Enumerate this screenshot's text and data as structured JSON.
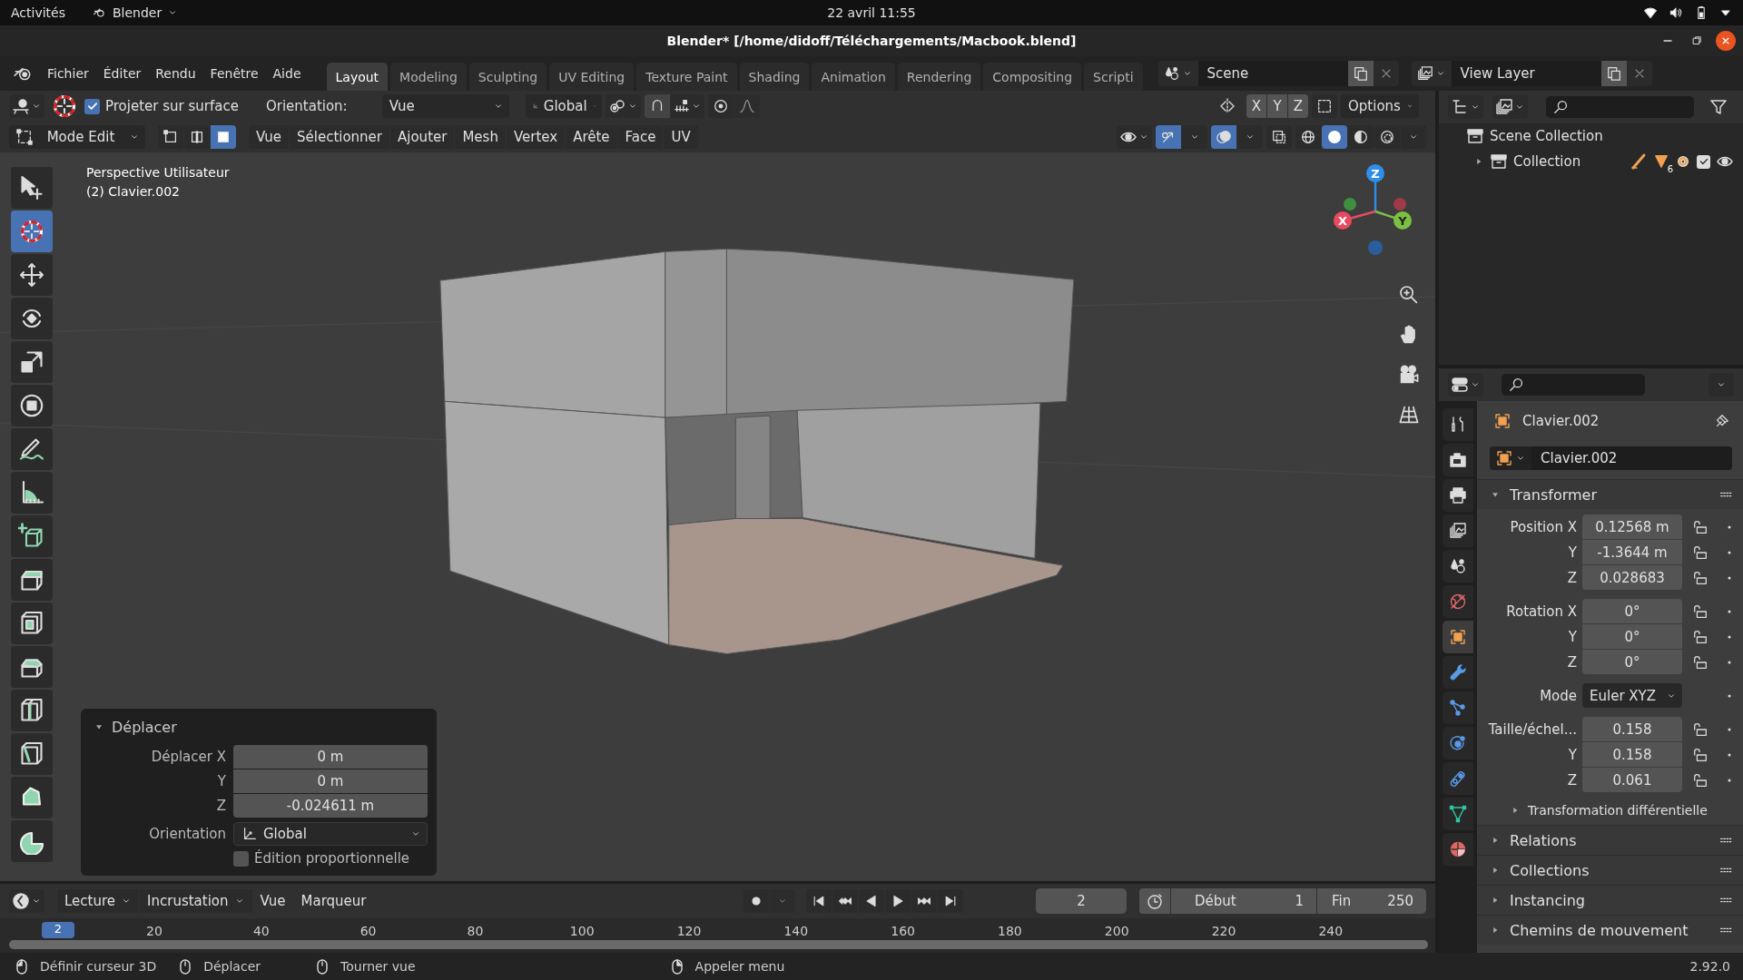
{
  "system_bar": {
    "activities": "Activités",
    "app": "Blender",
    "clock": "22 avril 11:55"
  },
  "window": {
    "title": "Blender* [/home/didoff/Téléchargements/Macbook.blend]"
  },
  "menu": [
    "Fichier",
    "Éditer",
    "Rendu",
    "Fenêtre",
    "Aide"
  ],
  "workspaces": [
    {
      "label": "Layout",
      "selected": true
    },
    {
      "label": "Modeling",
      "selected": false
    },
    {
      "label": "Sculpting",
      "selected": false
    },
    {
      "label": "UV Editing",
      "selected": false
    },
    {
      "label": "Texture Paint",
      "selected": false
    },
    {
      "label": "Shading",
      "selected": false
    },
    {
      "label": "Animation",
      "selected": false
    },
    {
      "label": "Rendering",
      "selected": false
    },
    {
      "label": "Compositing",
      "selected": false
    },
    {
      "label": "Scripti",
      "selected": false
    }
  ],
  "scene": "Scene",
  "view_layer": "View Layer",
  "tool_settings": {
    "project": {
      "label": "Projeter sur surface",
      "checked": true
    },
    "orientation_label": "Orientation:",
    "orientation_value": "Vue",
    "transform": "Global",
    "axes": [
      "X",
      "Y",
      "Z"
    ],
    "options": "Options"
  },
  "mode_header": {
    "mode": "Mode Edit",
    "select_modes": [
      {
        "selected": false
      },
      {
        "selected": false
      },
      {
        "selected": true
      }
    ],
    "menus": [
      "Vue",
      "Sélectionner",
      "Ajouter",
      "Mesh",
      "Vertex",
      "Arête",
      "Face",
      "UV"
    ],
    "shading": [
      {
        "selected": false
      },
      {
        "selected": true
      },
      {
        "selected": false
      },
      {
        "selected": false
      }
    ]
  },
  "toolbar": [
    {
      "kind": "select",
      "selected": false
    },
    {
      "kind": "cursor",
      "selected": true
    },
    {
      "kind": "move",
      "selected": false
    },
    {
      "kind": "rotate",
      "selected": false
    },
    {
      "kind": "scale",
      "selected": false
    },
    {
      "kind": "transform",
      "selected": false
    },
    {
      "kind": "annotate",
      "selected": false
    },
    {
      "kind": "measure",
      "selected": false
    },
    {
      "kind": "add_cube",
      "selected": false
    },
    {
      "kind": "extrude",
      "selected": false
    },
    {
      "kind": "inset",
      "selected": false
    },
    {
      "kind": "bevel",
      "selected": false
    },
    {
      "kind": "loop_cut",
      "selected": false
    },
    {
      "kind": "knife",
      "selected": false
    },
    {
      "kind": "poly_build",
      "selected": false
    },
    {
      "kind": "spin",
      "selected": false
    }
  ],
  "viewport": {
    "overlay_lines": [
      "Perspective Utilisateur",
      "(2) Clavier.002"
    ],
    "gizmo_labels": [
      "X",
      "Y",
      "Z"
    ]
  },
  "last_operator": {
    "title": "Déplacer",
    "expanded": true,
    "fields": [
      {
        "label": "Déplacer X",
        "value": "0 m"
      },
      {
        "label": "Y",
        "value": "0 m"
      },
      {
        "label": "Z",
        "value": "-0.024611 m"
      }
    ],
    "orientation_label": "Orientation",
    "orientation_value": "Global",
    "proportional": {
      "label": "Édition proportionnelle",
      "checked": false
    }
  },
  "timeline": {
    "menus": [
      "Lecture",
      "Incrustation",
      "Vue",
      "Marqueur"
    ],
    "current_frame": "2",
    "playhead_label": "2",
    "start_label": "Début",
    "start": "1",
    "end_label": "Fin",
    "end": "250",
    "ruler": [
      "20",
      "40",
      "60",
      "80",
      "100",
      "120",
      "140",
      "160",
      "180",
      "200",
      "220",
      "240"
    ]
  },
  "outliner": {
    "items": [
      {
        "label": "Scene Collection",
        "children": [
          {
            "label": "Collection",
            "expanded": false,
            "badge": "6",
            "included": true
          }
        ]
      }
    ]
  },
  "properties": {
    "tabs": [
      {
        "kind": "tool",
        "selected": false
      },
      {
        "kind": "render",
        "selected": false
      },
      {
        "kind": "output",
        "selected": false
      },
      {
        "kind": "view_layer",
        "selected": false
      },
      {
        "kind": "scene",
        "selected": false
      },
      {
        "kind": "world",
        "selected": false
      },
      {
        "kind": "object",
        "selected": true
      },
      {
        "kind": "modifiers",
        "selected": false
      },
      {
        "kind": "particles",
        "selected": false
      },
      {
        "kind": "physics",
        "selected": false
      },
      {
        "kind": "constraints",
        "selected": false
      },
      {
        "kind": "data",
        "selected": false
      },
      {
        "kind": "material",
        "selected": false
      }
    ],
    "object_name": "Clavier.002",
    "data_name": "Clavier.002",
    "transform": {
      "title": "Transformer",
      "expanded": true,
      "rows": [
        {
          "kind": "field",
          "label": "Position X",
          "value": "0.12568 m",
          "group_start": true
        },
        {
          "kind": "field",
          "label": "Y",
          "value": "-1.3644 m",
          "group_start": false
        },
        {
          "kind": "field",
          "label": "Z",
          "value": "0.028683",
          "group_start": false
        },
        {
          "kind": "field",
          "label": "Rotation X",
          "value": "0°",
          "group_start": true
        },
        {
          "kind": "field",
          "label": "Y",
          "value": "0°",
          "group_start": false
        },
        {
          "kind": "field",
          "label": "Z",
          "value": "0°",
          "group_start": false
        },
        {
          "kind": "dropdown",
          "label": "Mode",
          "value": "Euler XYZ",
          "group_start": true
        },
        {
          "kind": "field",
          "label": "Taille/échel...",
          "value": "0.158",
          "group_start": true
        },
        {
          "kind": "field",
          "label": "Y",
          "value": "0.158",
          "group_start": false
        },
        {
          "kind": "field",
          "label": "Z",
          "value": "0.061",
          "group_start": false
        }
      ],
      "subpanel": {
        "title": "Transformation différentielle",
        "expanded": false
      }
    },
    "panels": [
      {
        "title": "Relations",
        "expanded": false
      },
      {
        "title": "Collections",
        "expanded": false
      },
      {
        "title": "Instancing",
        "expanded": false
      },
      {
        "title": "Chemins de mouvement",
        "expanded": false
      }
    ]
  },
  "status_bar": {
    "hints": [
      "Définir curseur 3D",
      "Déplacer",
      "Tourner vue",
      "Appeler menu"
    ],
    "version": "2.92.0"
  }
}
